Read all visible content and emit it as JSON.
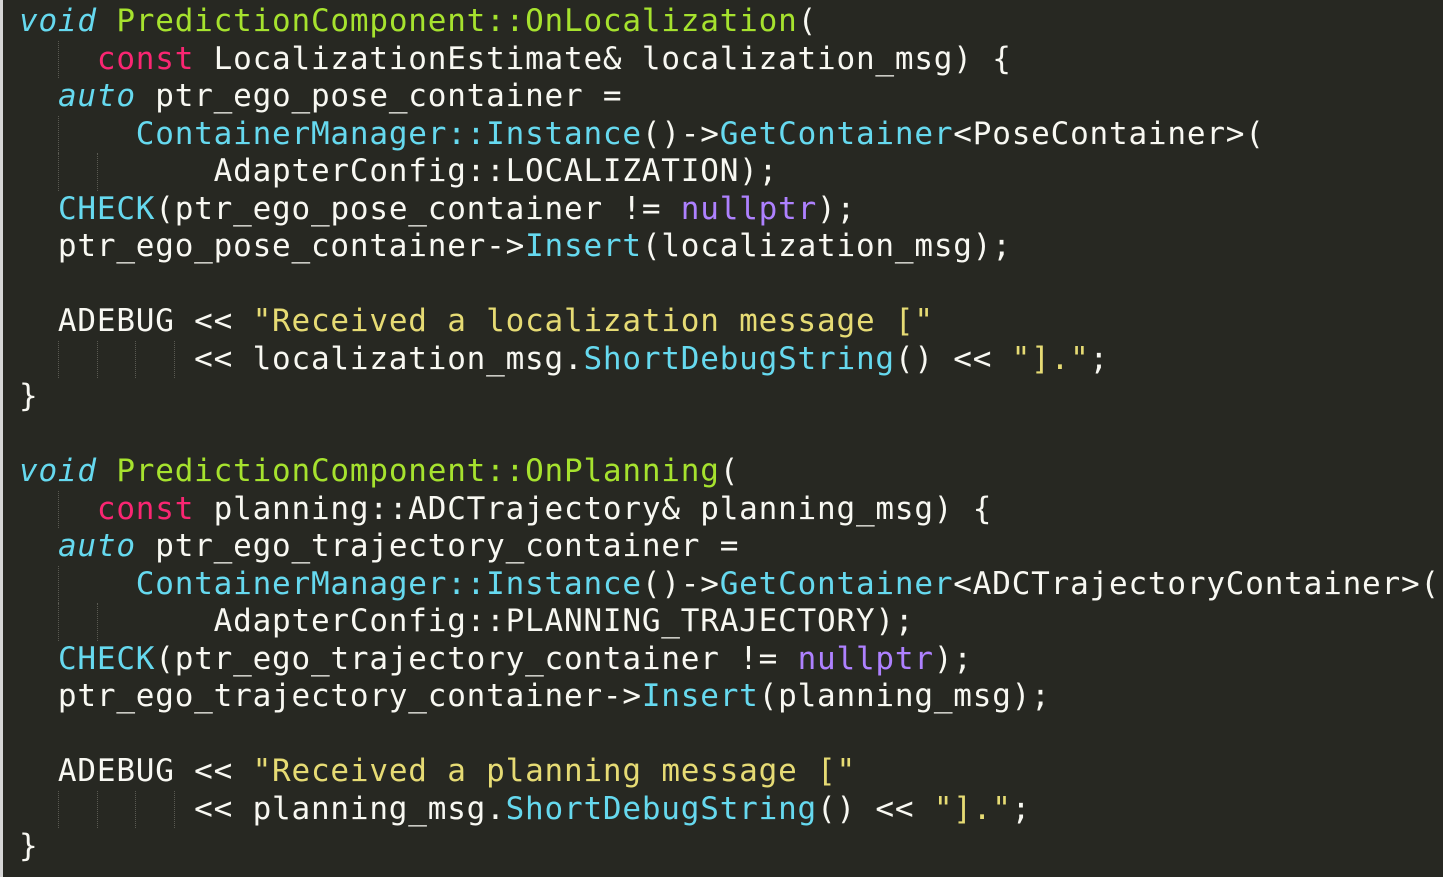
{
  "editor": {
    "theme_colors": {
      "background": "#272822",
      "plain": "#f8f8f2",
      "keyword_italic": "#66d9ef",
      "function_name": "#a6e22e",
      "keyword": "#f92672",
      "call": "#66d9ef",
      "constant": "#ae81ff",
      "string": "#e6db74"
    },
    "lines": [
      {
        "guides": 0,
        "tokens": [
          {
            "t": "void",
            "c": "kwi"
          },
          {
            "t": " ",
            "c": "plain"
          },
          {
            "t": "PredictionComponent::OnLocalization",
            "c": "fn"
          },
          {
            "t": "(",
            "c": "plain"
          }
        ]
      },
      {
        "guides": 1,
        "tokens": [
          {
            "t": "    ",
            "c": "plain"
          },
          {
            "t": "const",
            "c": "kw"
          },
          {
            "t": " LocalizationEstimate& localization_msg) {",
            "c": "plain"
          }
        ]
      },
      {
        "guides": 0,
        "tokens": [
          {
            "t": "  ",
            "c": "plain"
          },
          {
            "t": "auto",
            "c": "kwi"
          },
          {
            "t": " ptr_ego_pose_container =",
            "c": "plain"
          }
        ]
      },
      {
        "guides": 1,
        "tokens": [
          {
            "t": "      ",
            "c": "plain"
          },
          {
            "t": "ContainerManager::Instance",
            "c": "call"
          },
          {
            "t": "()->",
            "c": "plain"
          },
          {
            "t": "GetContainer",
            "c": "call"
          },
          {
            "t": "<PoseContainer>(",
            "c": "plain"
          }
        ]
      },
      {
        "guides": 2,
        "tokens": [
          {
            "t": "          AdapterConfig::LOCALIZATION);",
            "c": "plain"
          }
        ]
      },
      {
        "guides": 0,
        "tokens": [
          {
            "t": "  ",
            "c": "plain"
          },
          {
            "t": "CHECK",
            "c": "call"
          },
          {
            "t": "(ptr_ego_pose_container != ",
            "c": "plain"
          },
          {
            "t": "nullptr",
            "c": "const"
          },
          {
            "t": ");",
            "c": "plain"
          }
        ]
      },
      {
        "guides": 0,
        "tokens": [
          {
            "t": "  ptr_ego_pose_container->",
            "c": "plain"
          },
          {
            "t": "Insert",
            "c": "call"
          },
          {
            "t": "(localization_msg);",
            "c": "plain"
          }
        ]
      },
      {
        "guides": 0,
        "tokens": []
      },
      {
        "guides": 0,
        "tokens": [
          {
            "t": "  ADEBUG << ",
            "c": "plain"
          },
          {
            "t": "\"Received a localization message [\"",
            "c": "str"
          }
        ]
      },
      {
        "guides": 4,
        "tokens": [
          {
            "t": "         << localization_msg.",
            "c": "plain"
          },
          {
            "t": "ShortDebugString",
            "c": "call"
          },
          {
            "t": "() << ",
            "c": "plain"
          },
          {
            "t": "\"].\"",
            "c": "str"
          },
          {
            "t": ";",
            "c": "plain"
          }
        ]
      },
      {
        "guides": 0,
        "tokens": [
          {
            "t": "}",
            "c": "plain"
          }
        ]
      },
      {
        "guides": 0,
        "tokens": []
      },
      {
        "guides": 0,
        "tokens": [
          {
            "t": "void",
            "c": "kwi"
          },
          {
            "t": " ",
            "c": "plain"
          },
          {
            "t": "PredictionComponent::OnPlanning",
            "c": "fn"
          },
          {
            "t": "(",
            "c": "plain"
          }
        ]
      },
      {
        "guides": 1,
        "tokens": [
          {
            "t": "    ",
            "c": "plain"
          },
          {
            "t": "const",
            "c": "kw"
          },
          {
            "t": " planning::ADCTrajectory& planning_msg) {",
            "c": "plain"
          }
        ]
      },
      {
        "guides": 0,
        "tokens": [
          {
            "t": "  ",
            "c": "plain"
          },
          {
            "t": "auto",
            "c": "kwi"
          },
          {
            "t": " ptr_ego_trajectory_container =",
            "c": "plain"
          }
        ]
      },
      {
        "guides": 1,
        "tokens": [
          {
            "t": "      ",
            "c": "plain"
          },
          {
            "t": "ContainerManager::Instance",
            "c": "call"
          },
          {
            "t": "()->",
            "c": "plain"
          },
          {
            "t": "GetContainer",
            "c": "call"
          },
          {
            "t": "<ADCTrajectoryContainer>(",
            "c": "plain"
          }
        ]
      },
      {
        "guides": 2,
        "tokens": [
          {
            "t": "          AdapterConfig::PLANNING_TRAJECTORY);",
            "c": "plain"
          }
        ]
      },
      {
        "guides": 0,
        "tokens": [
          {
            "t": "  ",
            "c": "plain"
          },
          {
            "t": "CHECK",
            "c": "call"
          },
          {
            "t": "(ptr_ego_trajectory_container != ",
            "c": "plain"
          },
          {
            "t": "nullptr",
            "c": "const"
          },
          {
            "t": ");",
            "c": "plain"
          }
        ]
      },
      {
        "guides": 0,
        "tokens": [
          {
            "t": "  ptr_ego_trajectory_container->",
            "c": "plain"
          },
          {
            "t": "Insert",
            "c": "call"
          },
          {
            "t": "(planning_msg);",
            "c": "plain"
          }
        ]
      },
      {
        "guides": 0,
        "tokens": []
      },
      {
        "guides": 0,
        "tokens": [
          {
            "t": "  ADEBUG << ",
            "c": "plain"
          },
          {
            "t": "\"Received a planning message [\"",
            "c": "str"
          }
        ]
      },
      {
        "guides": 4,
        "tokens": [
          {
            "t": "         << planning_msg.",
            "c": "plain"
          },
          {
            "t": "ShortDebugString",
            "c": "call"
          },
          {
            "t": "() << ",
            "c": "plain"
          },
          {
            "t": "\"].\"",
            "c": "str"
          },
          {
            "t": ";",
            "c": "plain"
          }
        ]
      },
      {
        "guides": 0,
        "tokens": [
          {
            "t": "}",
            "c": "plain"
          }
        ]
      }
    ]
  }
}
